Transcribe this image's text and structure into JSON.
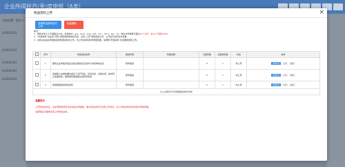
{
  "background": {
    "title": "企业所得税月(季)度申报（A类）",
    "left_lines": [
      "当前位置：首页 > ...",
      "(A201010)",
      "(A201020)",
      "(A201030)",
      "(A201040)",
      "(A201050)"
    ]
  },
  "modal": {
    "title": "附送资料上传",
    "close_glyph": "×",
    "buttons": {
      "upload": "选择附送资料进行上传",
      "clear": "批量删除"
    },
    "notes": {
      "label": "提示：",
      "line1a": "1、单张文件大小不得超过10M，支持格式：jpg、bmp、png、pdf、doc、docx、zip、rar，单次文件数量不超过",
      "line1b": "20个文件，总大小不超过50M。",
      "line2": "2、“附送资料”请点击“浏览”按钮选择本地文件后，点击“上传”按钮完成上传，上传后可在列表中查看。",
      "line3": "3、请务必在提交申报前完成附送资料的上传，未上传资料将影响申报受理，请按照“附送资料”栏目要求逐项上传。"
    },
    "table": {
      "headers": [
        "",
        "序号",
        "附送资料名称",
        "报送时限",
        "附报说明",
        "已报份数",
        "应报送份数",
        "状态",
        "操作"
      ],
      "rows": [
        {
          "no": "1",
          "name": "居民企业参股外国企业信息报告表及境外分支机构信息表",
          "time": "按年报送",
          "desc": "",
          "done": "0",
          "need": "1",
          "status": "未上传",
          "ops": [
            "选择文件",
            "上传",
            "删除"
          ]
        },
        {
          "no": "2",
          "name": "如纳税人在报告期内发生了资产损失、境外投资、关联交易、技术转让等事项的，需按规定报送相关资料附件等",
          "time": "按年报送",
          "desc": "",
          "done": "0",
          "need": "1",
          "status": "未上传",
          "ops": [
            "选择文件",
            "上传",
            "删除"
          ]
        },
        {
          "no": "3",
          "name": "其他需报送的附送资料",
          "time": "按年报送",
          "desc": "",
          "done": "0",
          "need": "1",
          "status": "未上传",
          "ops": [
            "选择文件",
            "上传",
            "删除"
          ]
        }
      ],
      "footer": "（以上资料仅为可选择报送资料清单）"
    },
    "hint": {
      "title": "温馨提示",
      "line1": "上传附送资料后，请在申报表填写完成并提交申报前，确认附送资料已全部上传成功，未上传的资料将影响您的申报受理。",
      "line2": "请按照提示要求逐项上传附送资料。"
    }
  }
}
